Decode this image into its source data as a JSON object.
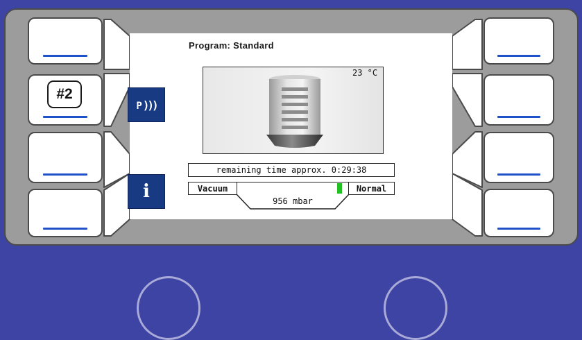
{
  "display": {
    "program": "Program: Standard",
    "temperature": "23 °C",
    "remaining_time": "remaining time approx. 0:29:38",
    "vacuum_label": "Vacuum",
    "normal_label": "Normal",
    "pressure": "956 mbar",
    "vacuum_level_fraction": 0.95
  },
  "side_buttons": {
    "program_icon_letter": "P",
    "program_icon_waves": ")))",
    "program_icon": "wireless-program-icon",
    "info_label": "i",
    "info_icon": "info-icon"
  },
  "annotation": {
    "badge": "#2"
  },
  "colors": {
    "panel_background": "#3e44a4",
    "bezel": "#9c9c9c",
    "side_button": "#183a82",
    "softkey_line": "#1f52c8",
    "vacuum_indicator": "#22c022"
  }
}
